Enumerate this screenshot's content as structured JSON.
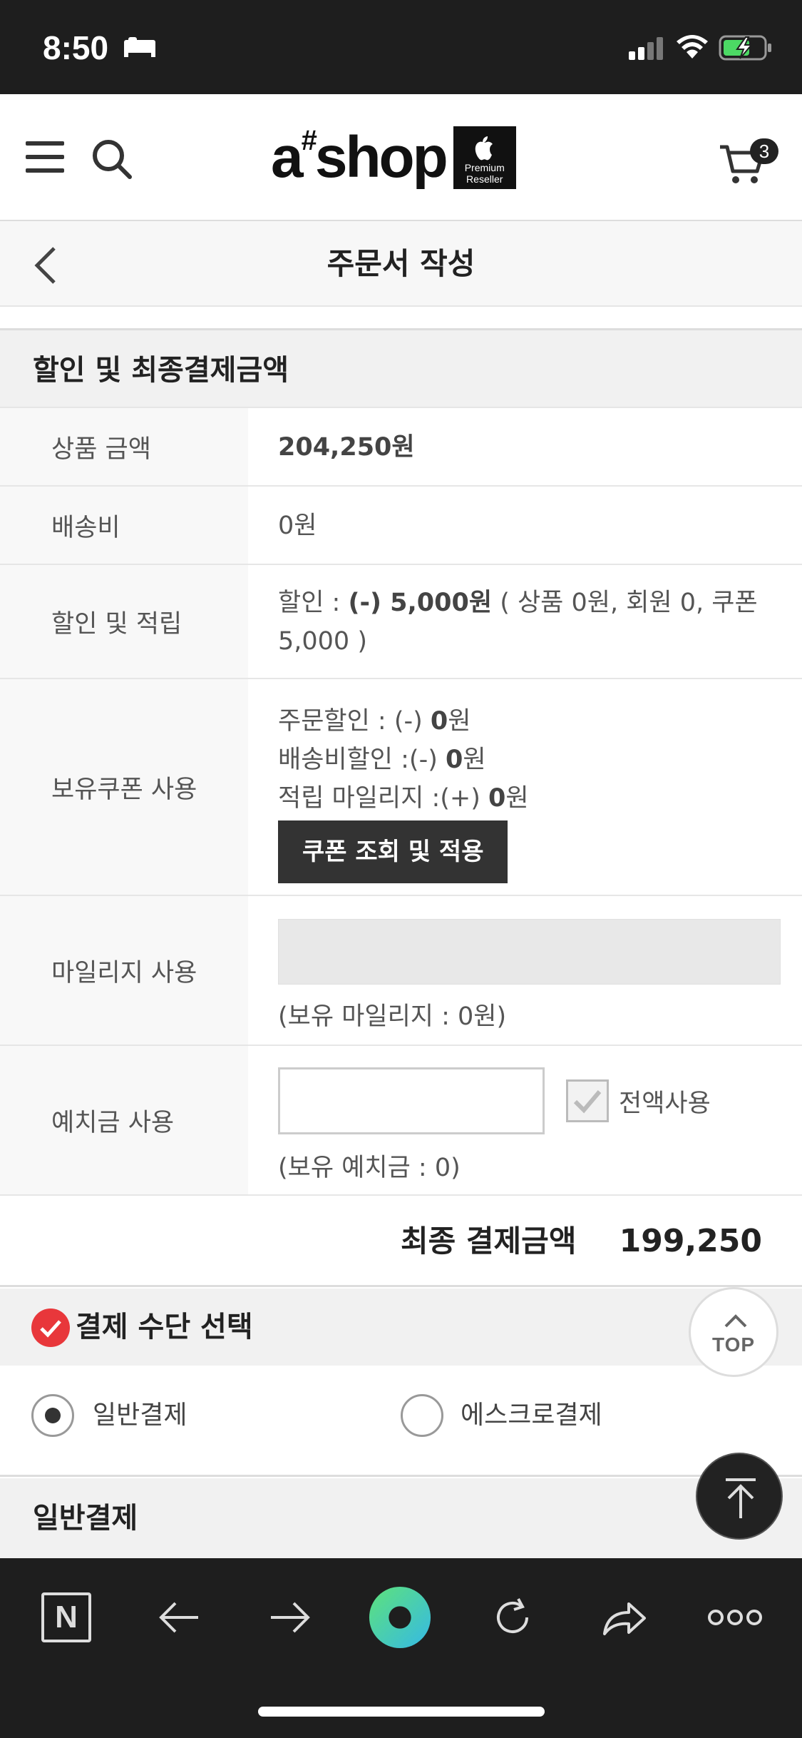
{
  "status_bar": {
    "time": "8:50"
  },
  "header": {
    "logo_text": "a",
    "logo_sup": "#",
    "logo_shop": "shop",
    "badge_line1": "Premium",
    "badge_line2": "Reseller",
    "cart_count": "3"
  },
  "page": {
    "title": "주문서 작성"
  },
  "discount_section": {
    "heading": "할인 및 최종결제금액",
    "product_amount": {
      "label": "상품 금액",
      "value": "204,250원"
    },
    "shipping": {
      "label": "배송비",
      "value": "0원"
    },
    "discount": {
      "label": "할인 및 적립",
      "prefix": "할인 : ",
      "amount": "(-) 5,000원",
      "detail": " ( 상품 0원, 회원 0, 쿠폰 5,000 )"
    },
    "coupon": {
      "label": "보유쿠폰 사용",
      "order_discount_label": "주문할인 : (-) ",
      "order_discount_value": "0",
      "order_discount_unit": "원",
      "shipping_discount_label": "배송비할인 :(-) ",
      "shipping_discount_value": "0",
      "shipping_discount_unit": "원",
      "mileage_label": "적립 마일리지 :(+) ",
      "mileage_value": "0",
      "mileage_unit": "원",
      "button": "쿠폰 조회 및 적용"
    },
    "mileage": {
      "label": "마일리지 사용",
      "input_value": "",
      "note": "(보유 마일리지 : 0원)"
    },
    "deposit": {
      "label": "예치금 사용",
      "input_value": "",
      "checkbox_label": "전액사용",
      "note": "(보유 예치금 : 0)"
    },
    "total": {
      "label": "최종 결제금액",
      "value": "199,250"
    }
  },
  "payment": {
    "heading": "결제 수단 선택",
    "options": [
      {
        "label": "일반결제",
        "selected": true
      },
      {
        "label": "에스크로결제",
        "selected": false
      }
    ],
    "general_heading": "일반결제"
  },
  "top_button": {
    "label": "TOP"
  },
  "browser_toolbar": {
    "n_label": "N"
  },
  "colors": {
    "accent_red": "#e8373b",
    "dark": "#1e1e1e",
    "green_dot": "#4fdf9a"
  }
}
